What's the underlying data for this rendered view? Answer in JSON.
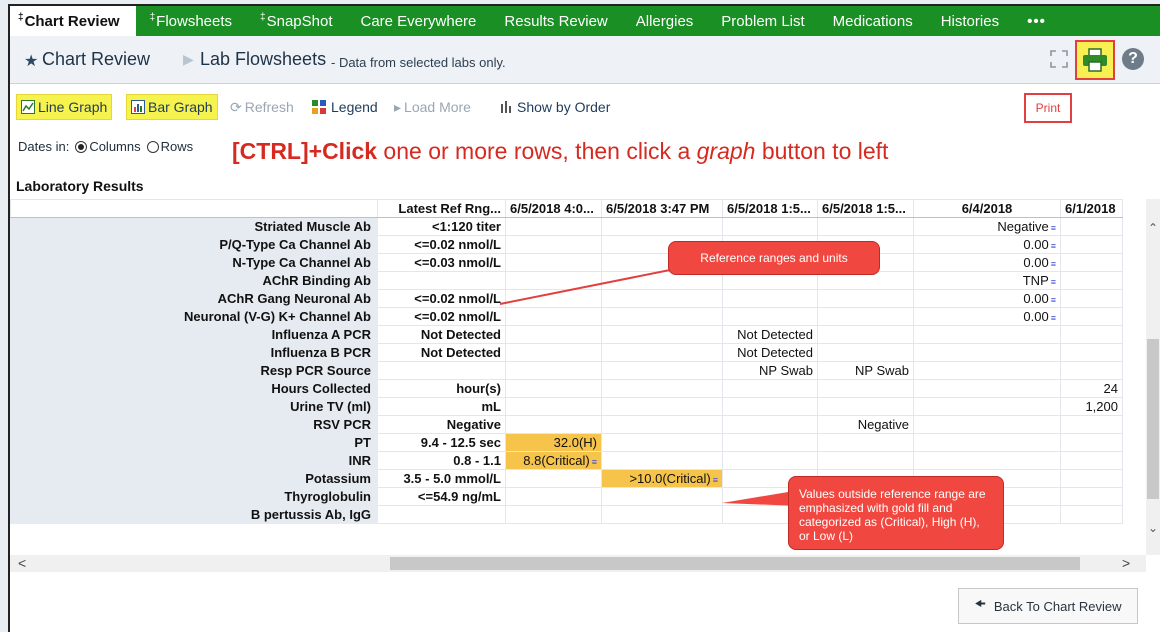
{
  "tabs": [
    {
      "label": "Chart Review",
      "marker": "‡",
      "active": true
    },
    {
      "label": "Flowsheets",
      "marker": "‡"
    },
    {
      "label": "SnapShot",
      "marker": "‡"
    },
    {
      "label": "Care Everywhere"
    },
    {
      "label": "Results Review"
    },
    {
      "label": "Allergies"
    },
    {
      "label": "Problem List"
    },
    {
      "label": "Medications"
    },
    {
      "label": "Histories"
    },
    {
      "label": "•••"
    }
  ],
  "header": {
    "chart_review": "Chart Review",
    "lab_flowsheets": "Lab Flowsheets",
    "subtitle": "- Data from selected labs only."
  },
  "toolbar": {
    "line_graph": "Line Graph",
    "bar_graph": "Bar Graph",
    "refresh": "Refresh",
    "legend": "Legend",
    "load_more": "Load More",
    "show_by_order": "Show by Order"
  },
  "print_callout": "Print",
  "dates_in": {
    "label": "Dates in:",
    "columns": "Columns",
    "rows": "Rows",
    "selected": "Columns"
  },
  "instruction": {
    "bold": "[CTRL]+Click",
    "mid": " one or more rows, then click a ",
    "ital": "graph",
    "end": " button to left"
  },
  "section_title": "Laboratory Results",
  "grid": {
    "columns": [
      "",
      "Latest Ref Rng...",
      "6/5/2018 4:0...",
      "6/5/2018 3:47 PM",
      "6/5/2018 1:5...",
      "6/5/2018 1:5...",
      "6/4/2018",
      "6/1/2018"
    ],
    "rows": [
      {
        "name": "Striated Muscle Ab",
        "ref": "<1:120 titer",
        "cells": [
          "",
          "",
          "",
          "",
          "Negative",
          ""
        ]
      },
      {
        "name": "P/Q-Type Ca Channel Ab",
        "ref": "<=0.02 nmol/L",
        "cells": [
          "",
          "",
          "",
          "",
          "0.00",
          ""
        ]
      },
      {
        "name": "N-Type Ca Channel Ab",
        "ref": "<=0.03 nmol/L",
        "cells": [
          "",
          "",
          "",
          "",
          "0.00",
          ""
        ]
      },
      {
        "name": "AChR Binding Ab",
        "ref": "",
        "cells": [
          "",
          "",
          "",
          "",
          "TNP",
          ""
        ]
      },
      {
        "name": "AChR Gang Neuronal Ab",
        "ref": "<=0.02 nmol/L",
        "cells": [
          "",
          "",
          "",
          "",
          "0.00",
          ""
        ]
      },
      {
        "name": "Neuronal (V-G) K+ Channel Ab",
        "ref": "<=0.02 nmol/L",
        "cells": [
          "",
          "",
          "",
          "",
          "0.00",
          ""
        ]
      },
      {
        "name": "Influenza A PCR",
        "ref": "Not Detected",
        "cells": [
          "",
          "",
          "Not Detected",
          "",
          "",
          ""
        ]
      },
      {
        "name": "Influenza B PCR",
        "ref": "Not Detected",
        "cells": [
          "",
          "",
          "Not Detected",
          "",
          "",
          ""
        ]
      },
      {
        "name": "Resp PCR Source",
        "ref": "",
        "cells": [
          "",
          "",
          "NP Swab",
          "NP Swab",
          "",
          ""
        ]
      },
      {
        "name": "Hours Collected",
        "ref": "hour(s)",
        "cells": [
          "",
          "",
          "",
          "",
          "",
          "24"
        ]
      },
      {
        "name": "Urine TV (ml)",
        "ref": "mL",
        "cells": [
          "",
          "",
          "",
          "",
          "",
          "1,200"
        ]
      },
      {
        "name": "RSV PCR",
        "ref": "Negative",
        "cells": [
          "",
          "",
          "",
          "Negative",
          "",
          ""
        ]
      },
      {
        "name": "PT",
        "ref": "9.4 - 12.5 sec",
        "cells": [
          "32.0(H)",
          "",
          "",
          "",
          "",
          ""
        ]
      },
      {
        "name": "INR",
        "ref": "0.8 - 1.1",
        "cells": [
          "8.8(Critical)",
          "",
          "",
          "",
          "",
          ""
        ]
      },
      {
        "name": "Potassium",
        "ref": "3.5 - 5.0 mmol/L",
        "cells": [
          "",
          ">10.0(Critical)",
          "",
          "",
          "",
          ""
        ]
      },
      {
        "name": "Thyroglobulin",
        "ref": "<=54.9 ng/mL",
        "cells": [
          "",
          "",
          "",
          "",
          "",
          ""
        ]
      },
      {
        "name": "B pertussis Ab, IgG",
        "ref": "",
        "cells": [
          "",
          "",
          "",
          "",
          "",
          ""
        ]
      }
    ]
  },
  "callouts": {
    "ref_units": "Reference ranges and units",
    "out_of_range": "Values outside reference range are emphasized with gold fill and categorized as (Critical), High (H), or Low  (L)"
  },
  "back_button": "Back To Chart Review",
  "colors": {
    "tab_green": "#1a8f24",
    "highlight": "#f6f24e",
    "flag_gold": "#f6c44a",
    "callout_red": "#f04840"
  }
}
